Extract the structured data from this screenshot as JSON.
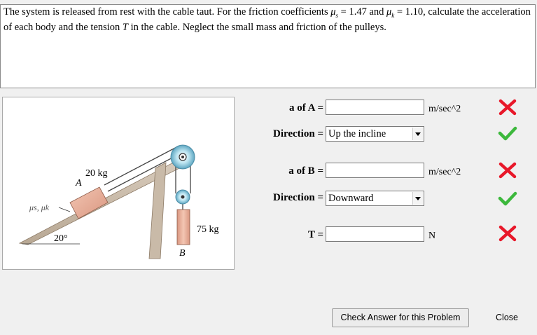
{
  "problem": {
    "text_1": "The system is released from rest with the cable taut. For the friction coefficients ",
    "mu_s_sym": "μ",
    "mu_s_sub": "s",
    "mu_s_val": " = 1.47 and ",
    "mu_k_sym": "μ",
    "mu_k_sub": "k",
    "mu_k_val": " = 1.10, calculate the acceleration of each body and the tension ",
    "T_sym": "T",
    "text_2": " in the cable. Neglect the small mass and friction of the pulleys."
  },
  "figure": {
    "mass_a": "20 kg",
    "label_a": "A",
    "mass_b": "75 kg",
    "label_b": "B",
    "angle": "20°",
    "friction_label": "μs, μk"
  },
  "fields": {
    "a_of_A": {
      "label": "a of A =",
      "value": "",
      "unit": "m/sec^2",
      "status": "incorrect"
    },
    "dir_A": {
      "label": "Direction =",
      "value": "Up the incline",
      "status": "correct"
    },
    "a_of_B": {
      "label": "a of B =",
      "value": "",
      "unit": "m/sec^2",
      "status": "incorrect"
    },
    "dir_B": {
      "label": "Direction =",
      "value": "Downward",
      "status": "correct"
    },
    "T": {
      "label": "T =",
      "value": "",
      "unit": "N",
      "status": "incorrect"
    }
  },
  "buttons": {
    "check": "Check Answer for this Problem",
    "close": "Close"
  },
  "colors": {
    "incorrect": "#e8182a",
    "correct": "#3cb83c"
  }
}
